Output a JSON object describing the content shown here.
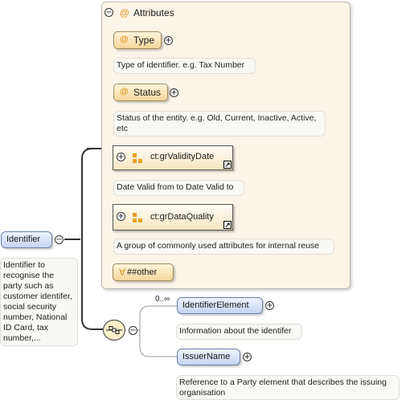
{
  "attributes": {
    "header": "Attributes",
    "type": {
      "name": "Type",
      "doc": "Type of identifier. e.g. Tax Number"
    },
    "status": {
      "name": "Status",
      "doc": "Status of the entity. e.g. Old, Current, Inactive, Active, etc"
    },
    "validity": {
      "name": "ct:grValidityDate",
      "doc": "Date Valid from to Date Valid to"
    },
    "quality": {
      "name": "ct:grDataQuality",
      "doc": "A group of commonly used attributes for internal reuse"
    },
    "other": "##other"
  },
  "root": {
    "name": "Identifier",
    "doc": "Identifier to recognise the party such as customer identifer, social security number, National ID Card, tax number,..."
  },
  "children": {
    "cardinality": "0..∞",
    "element": {
      "name": "IdentifierElement",
      "doc": "Information about the identifer"
    },
    "issuer": {
      "name": "IssuerName",
      "doc": "Reference to a Party element that describes the issuing organisation"
    }
  },
  "icons": [
    "collapse-icon",
    "expand-icon",
    "attribute-icon",
    "attribute-group-icon",
    "reference-link-icon",
    "sequence-icon"
  ]
}
